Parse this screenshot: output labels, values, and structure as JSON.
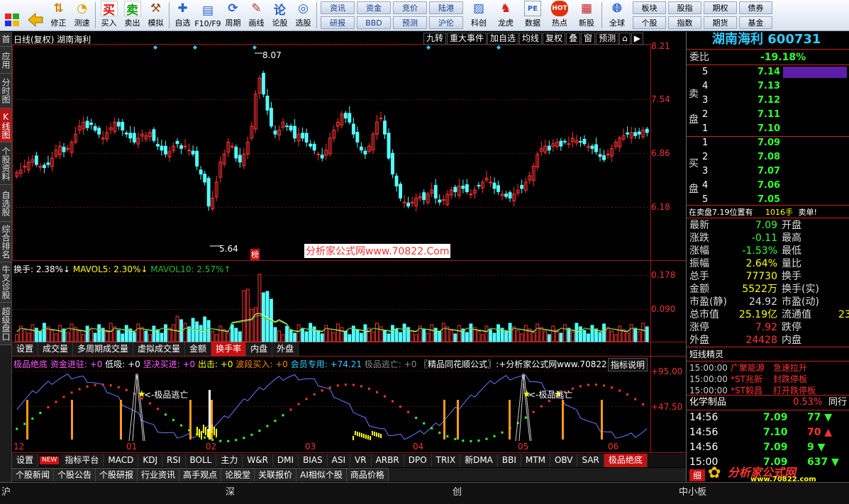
{
  "toolbar": {
    "buttons": [
      {
        "id": "home",
        "label": "",
        "icon": "grid-icon"
      },
      {
        "id": "back",
        "label": "",
        "icon": "arrow-left-icon"
      },
      {
        "id": "fix",
        "label": "修正",
        "icon": "up-down-arrow-icon"
      },
      {
        "id": "test",
        "label": "测速",
        "icon": "clock-icon"
      },
      {
        "id": "sep"
      },
      {
        "id": "buy",
        "label": "买入",
        "glyph": "买"
      },
      {
        "id": "sell",
        "label": "卖出",
        "glyph": "卖"
      },
      {
        "id": "sim",
        "label": "模拟",
        "icon": "hammer-icon"
      },
      {
        "id": "sep"
      },
      {
        "id": "self",
        "label": "自选",
        "icon": "plus-icon"
      },
      {
        "id": "f10",
        "label": "F10/F9",
        "icon": "info-icon"
      },
      {
        "id": "period",
        "label": "周期",
        "icon": "period-icon"
      },
      {
        "id": "draw",
        "label": "画线",
        "icon": "pencil-icon"
      },
      {
        "id": "lun",
        "label": "论股",
        "glyph": "论"
      },
      {
        "id": "pick",
        "label": "选股",
        "icon": "target-icon"
      }
    ],
    "grid_a": [
      "资讯",
      "资金",
      "竞价",
      "陆港",
      "研报",
      "BBD",
      "预测",
      "沪伦"
    ],
    "buttons2": [
      {
        "id": "kv",
        "label": "科创",
        "icon": "chart-icon"
      },
      {
        "id": "dragon",
        "label": "龙虎",
        "icon": "dragon-icon"
      },
      {
        "id": "data",
        "label": "数据",
        "glyph": "PE"
      },
      {
        "id": "hot",
        "label": "热点",
        "glyph": "HOT"
      },
      {
        "id": "new",
        "label": "新股",
        "icon": "new-stock-icon"
      },
      {
        "id": "global",
        "label": "全球",
        "icon": "globe-icon"
      }
    ],
    "grid_b": [
      "板块",
      "股指",
      "期权",
      "债券",
      "个股",
      "指数",
      "期货",
      "基金"
    ]
  },
  "leftnav": [
    "首页",
    "应用",
    "分时图",
    "K线图",
    "个股资料",
    "自选股",
    "综合排名",
    "牛叉诊股",
    "超级盘口"
  ],
  "leftnav_active": 3,
  "chart": {
    "title": "日线(复权)  湖南海利",
    "top_buttons": [
      "九转",
      "重大事件",
      "加自选",
      "均线",
      "复权",
      "叠",
      "窗",
      "预测",
      "⌂",
      "▶"
    ],
    "watermark": "分析家公式网www.70822.Com",
    "bang_label": "榜",
    "y_ticks_main": [
      "8.21",
      "7.54",
      "6.86",
      "6.18"
    ],
    "high_label": "8.07",
    "low_label": "5.64",
    "vol_legend": [
      {
        "text": "换手: 2.38%↓",
        "color": "#ffffff"
      },
      {
        "text": "MAVOL5: 2.30%↓",
        "color": "#ffff00"
      },
      {
        "text": "MAVOL10: 2.57%↑",
        "color": "#2ab82a"
      }
    ],
    "y_ticks_vol": [
      "0.178",
      "0.090"
    ],
    "tabs_mid": [
      "设置",
      "成交量",
      "多周期成交量",
      "虚拟成交量",
      "金额",
      "换手率",
      "内盘",
      "外盘"
    ],
    "tabs_mid_active": 5,
    "ind_legend": [
      {
        "text": "极品绝底",
        "color": "#ff5bff"
      },
      {
        "text": " 资金进驻: +0",
        "color": "#ff5bff"
      },
      {
        "text": " 低吸: +0",
        "color": "#ffffff"
      },
      {
        "text": " 坚决买进: +0",
        "color": "#ff5bff"
      },
      {
        "text": " 出击: +0",
        "color": "#ffff00"
      },
      {
        "text": " 波段买入: +0",
        "color": "#ff8800"
      },
      {
        "text": " 会员专用: +74.21",
        "color": "#3cf"
      },
      {
        "text": " 极品逃亡: +0",
        "color": "#888888"
      },
      {
        "text": " 〖精品同花顺公式〗:+分析家公式网www.70822.com",
        "color": "#ffffff"
      }
    ],
    "ind_button": "指标说明",
    "y_ticks_ind": [
      "+95.00",
      "+47.50"
    ],
    "escape_label": "<-极品逃亡",
    "x_labels": [
      "12",
      "01",
      "02",
      "03",
      "04",
      "05",
      "06"
    ],
    "tabs_bottom": [
      "设置",
      "NEW",
      "指标平台",
      "MACD",
      "KDJ",
      "RSI",
      "BOLL",
      "主力",
      "W&R",
      "DMI",
      "BIAS",
      "ASI",
      "VR",
      "ARBR",
      "DPO",
      "TRIX",
      "新DMA",
      "BBI",
      "MTM",
      "OBV",
      "SAR",
      "极品绝底"
    ],
    "tabs_bottom_active": 21
  },
  "bottom_tabs": [
    "个股新闻",
    "个股公告",
    "个股研报",
    "行业资讯",
    "高手观点",
    "论股堂",
    "关联报价",
    "AI相似个股",
    "商品价格"
  ],
  "status": [
    "沪",
    "深",
    "创",
    "中小板"
  ],
  "quote": {
    "name": "湖南海利",
    "code": "600731",
    "weibi_label": "委比",
    "weibi": "-19.18%",
    "sell_label": "卖盘",
    "buy_label": "买盘",
    "asks": [
      {
        "n": "5",
        "p": "7.14"
      },
      {
        "n": "4",
        "p": "7.13"
      },
      {
        "n": "3",
        "p": "7.12"
      },
      {
        "n": "2",
        "p": "7.11"
      },
      {
        "n": "1",
        "p": "7.10"
      }
    ],
    "bids": [
      {
        "n": "1",
        "p": "7.09"
      },
      {
        "n": "2",
        "p": "7.08"
      },
      {
        "n": "3",
        "p": "7.07"
      },
      {
        "n": "4",
        "p": "7.06"
      },
      {
        "n": "5",
        "p": "7.05"
      }
    ],
    "note": "在卖盘7.19位置有",
    "note_vol": "1016手",
    "note_tail": "卖单!",
    "stats": [
      {
        "k": "最新",
        "v": "7.09",
        "c": "#3f3",
        "k2": "开盘",
        "v2": ""
      },
      {
        "k": "涨跌",
        "v": "-0.11",
        "c": "#3f3",
        "k2": "最高",
        "v2": ""
      },
      {
        "k": "涨幅",
        "v": "-1.53%",
        "c": "#3f3",
        "k2": "最低",
        "v2": ""
      },
      {
        "k": "振幅",
        "v": "2.64%",
        "c": "#ffff00",
        "k2": "量比",
        "v2": ""
      },
      {
        "k": "总手",
        "v": "77730",
        "c": "#ffff00",
        "k2": "换手",
        "v2": ""
      },
      {
        "k": "金额",
        "v": "5522万",
        "c": "#ffff00",
        "k2": "换手(实)",
        "v2": ""
      },
      {
        "k": "市盈(静)",
        "v": "24.92",
        "c": "#ddd",
        "k2": "市盈(动)",
        "v2": ""
      },
      {
        "k": "总市值",
        "v": "25.19亿",
        "c": "#ffff00",
        "k2": "流通值",
        "v2": "23"
      },
      {
        "k": "涨停",
        "v": "7.92",
        "c": "#f33",
        "k2": "跌停",
        "v2": ""
      },
      {
        "k": "外盘",
        "v": "24428",
        "c": "#f33",
        "k2": "内盘",
        "v2": ""
      }
    ],
    "events_title": "短线精灵",
    "events": [
      {
        "t": "15:00:00",
        "s": "广聚能源",
        "m": "急速拉升"
      },
      {
        "t": "15:00:00",
        "s": "*ST兆新",
        "m": "封跌停板"
      },
      {
        "t": "15:00:00",
        "s": "*ST毅昌",
        "m": "打开跌停板"
      }
    ],
    "sector": {
      "name": "化学制品",
      "pct": "0.53%",
      "tail": "同行"
    },
    "ticks": [
      {
        "t": "14:56",
        "p": "7.09",
        "q": "77",
        "c": "#3f3",
        "a": "▼"
      },
      {
        "t": "14:56",
        "p": "7.10",
        "q": "70",
        "c": "#f33",
        "a": "▲"
      },
      {
        "t": "14:56",
        "p": "7.09",
        "q": "9",
        "c": "#3f3",
        "a": "▼"
      },
      {
        "t": "15:00",
        "p": "7.09",
        "q": "637",
        "c": "#3f3",
        "a": "▼"
      }
    ],
    "tick_tab": "细",
    "logo_text": "分析家公式网",
    "logo_url": "www.70822.com"
  }
}
